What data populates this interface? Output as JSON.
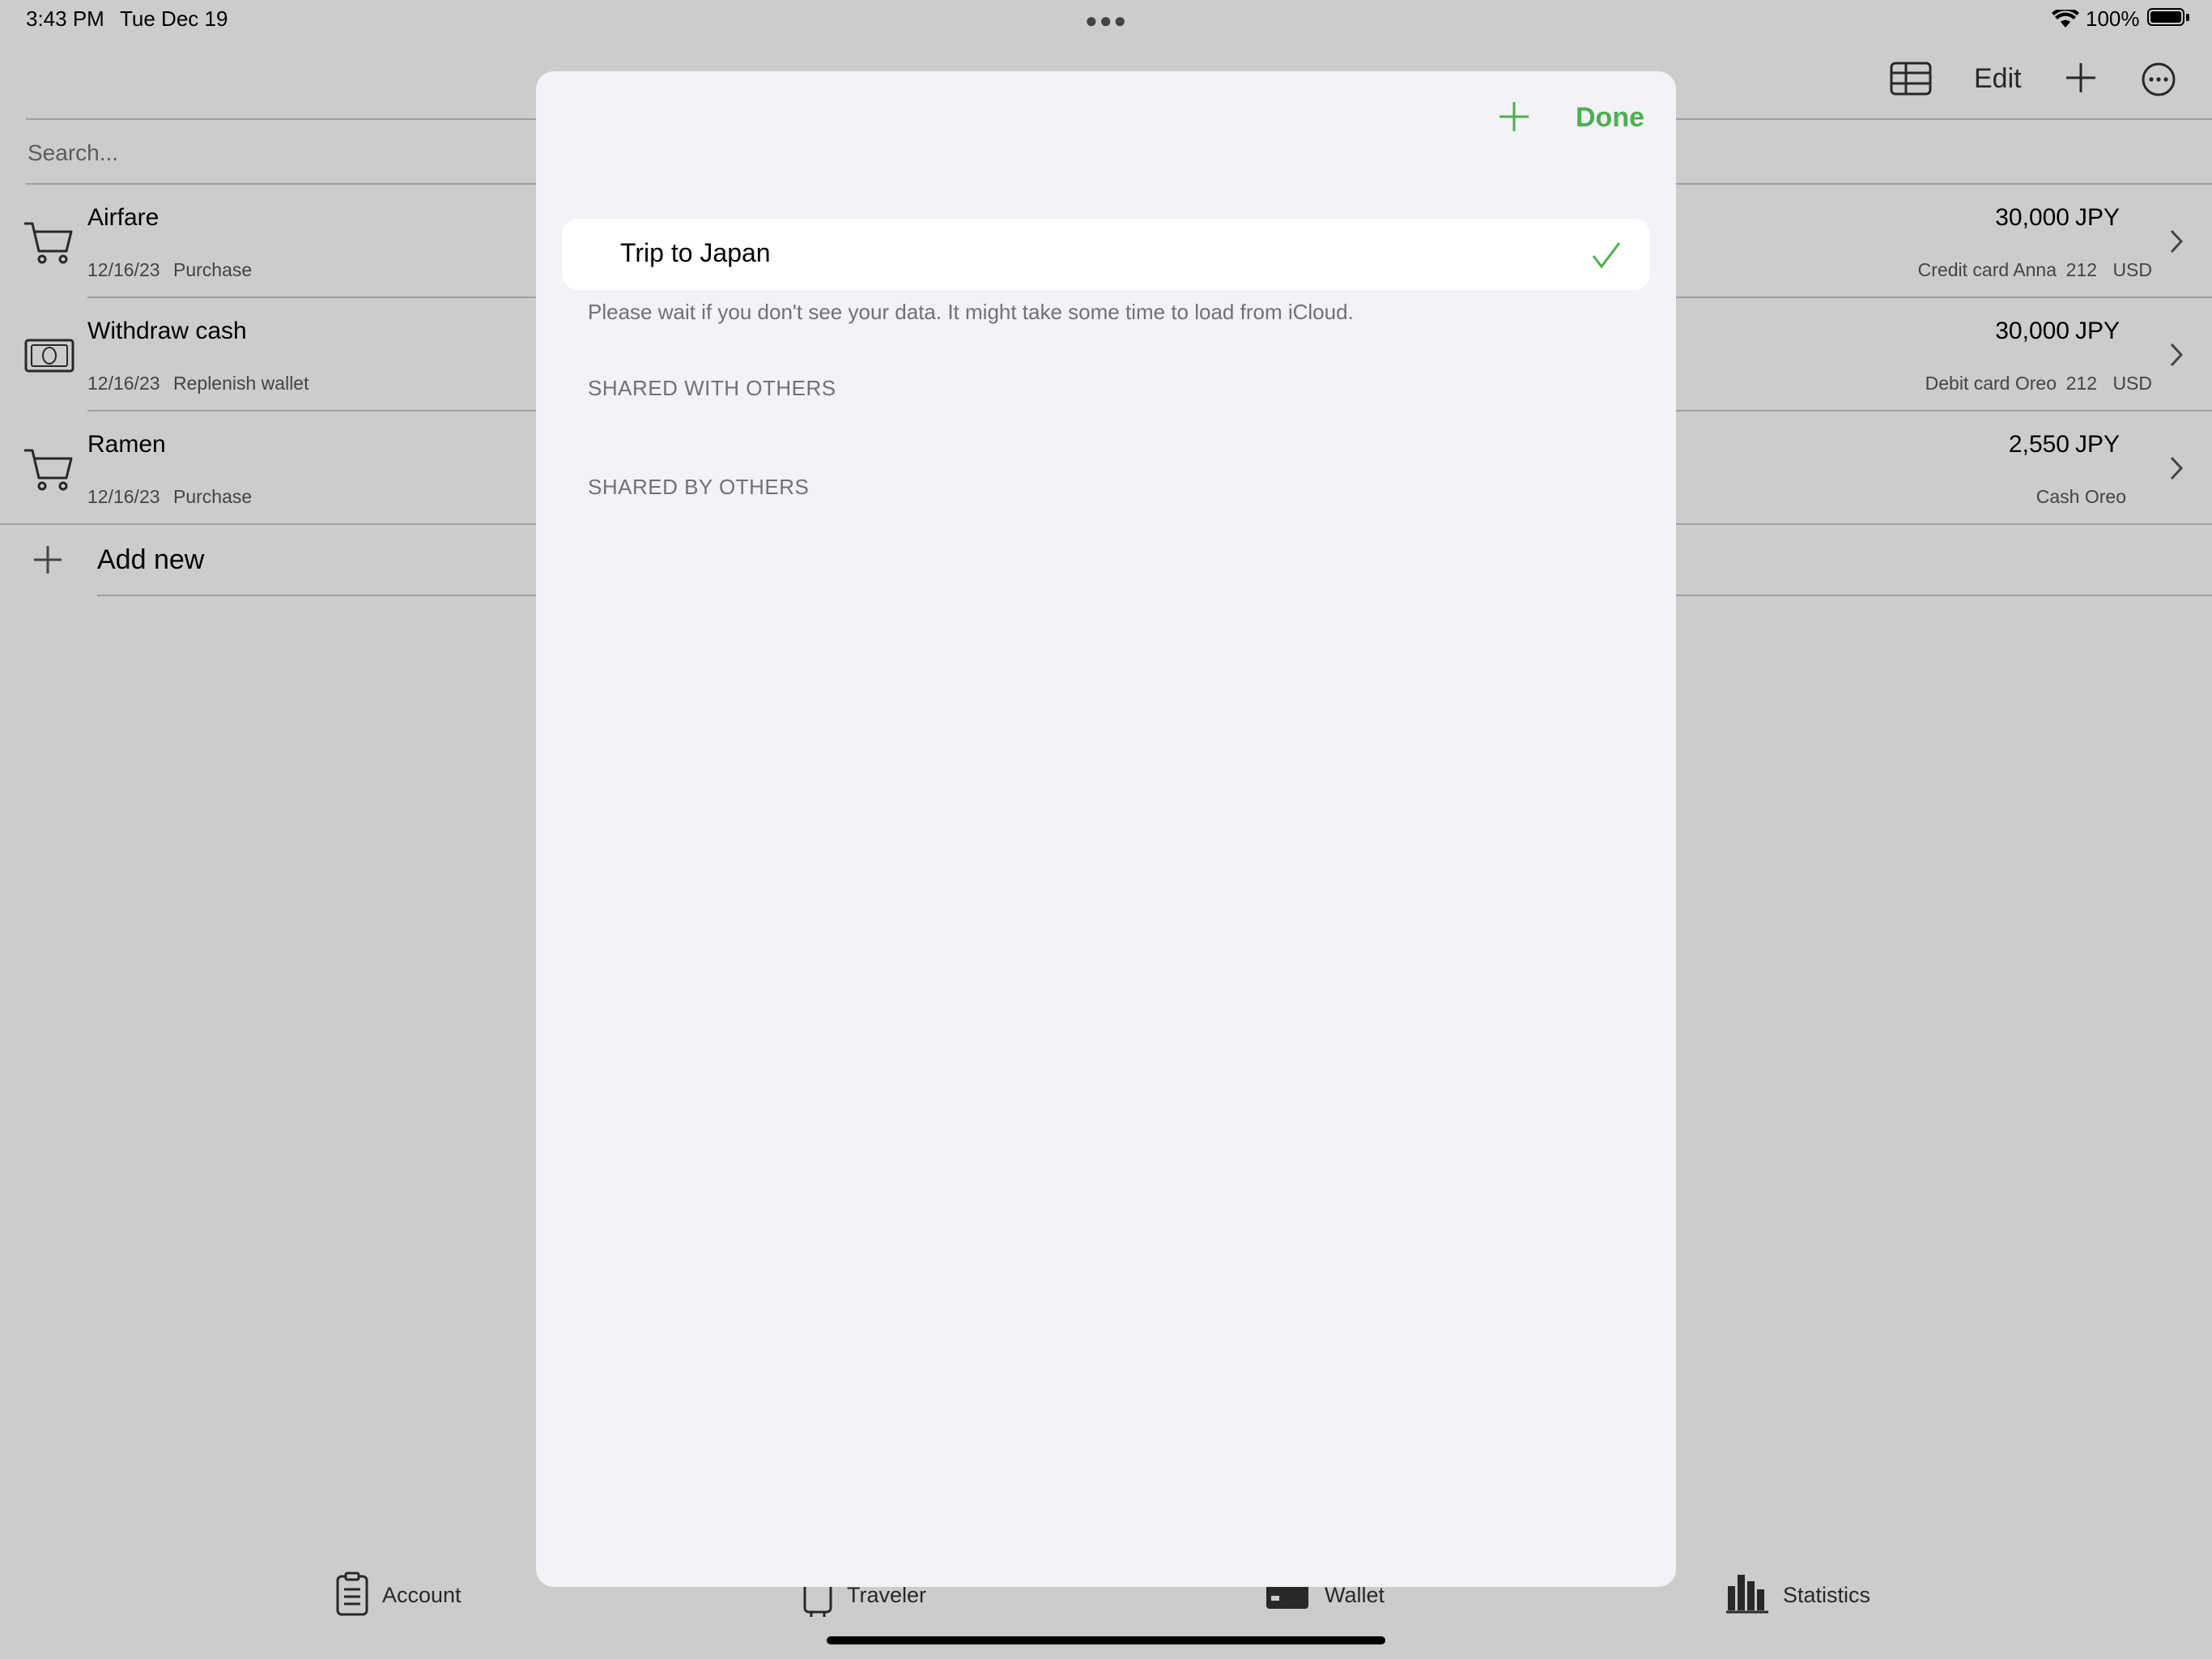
{
  "status_bar": {
    "time": "3:43 PM",
    "date": "Tue Dec 19",
    "battery": "100%"
  },
  "toolbar": {
    "edit_label": "Edit"
  },
  "search": {
    "placeholder": "Search..."
  },
  "transactions": [
    {
      "title": "Airfare",
      "date": "12/16/23",
      "type": "Purchase",
      "amount": "30,000",
      "currency": "JPY",
      "account": "Credit card Anna",
      "converted": "212",
      "converted_currency": "USD",
      "icon": "cart-icon"
    },
    {
      "title": "Withdraw cash",
      "date": "12/16/23",
      "type": "Replenish wallet",
      "amount": "30,000",
      "currency": "JPY",
      "account": "Debit card Oreo",
      "converted": "212",
      "converted_currency": "USD",
      "icon": "cash-icon"
    },
    {
      "title": "Ramen",
      "date": "12/16/23",
      "type": "Purchase",
      "amount": "2,550",
      "currency": "JPY",
      "account": "Cash Oreo",
      "converted": "",
      "converted_currency": "",
      "icon": "cart-icon"
    }
  ],
  "add_new_label": "Add new",
  "tab_bar": {
    "tabs": [
      {
        "label": "Account",
        "icon": "clipboard-icon"
      },
      {
        "label": "Traveler",
        "icon": "suitcase-icon"
      },
      {
        "label": "Wallet",
        "icon": "wallet-icon"
      },
      {
        "label": "Statistics",
        "icon": "bar-chart-icon"
      }
    ]
  },
  "modal": {
    "done_label": "Done",
    "selected_item": "Trip to Japan",
    "info_text": "Please wait if you don't see your data. It might take some time to load from iCloud.",
    "section_shared_with": "SHARED WITH OTHERS",
    "section_shared_by": "SHARED BY OTHERS"
  },
  "colors": {
    "accent": "#4cb050",
    "modal_bg": "#f2f2f7"
  }
}
